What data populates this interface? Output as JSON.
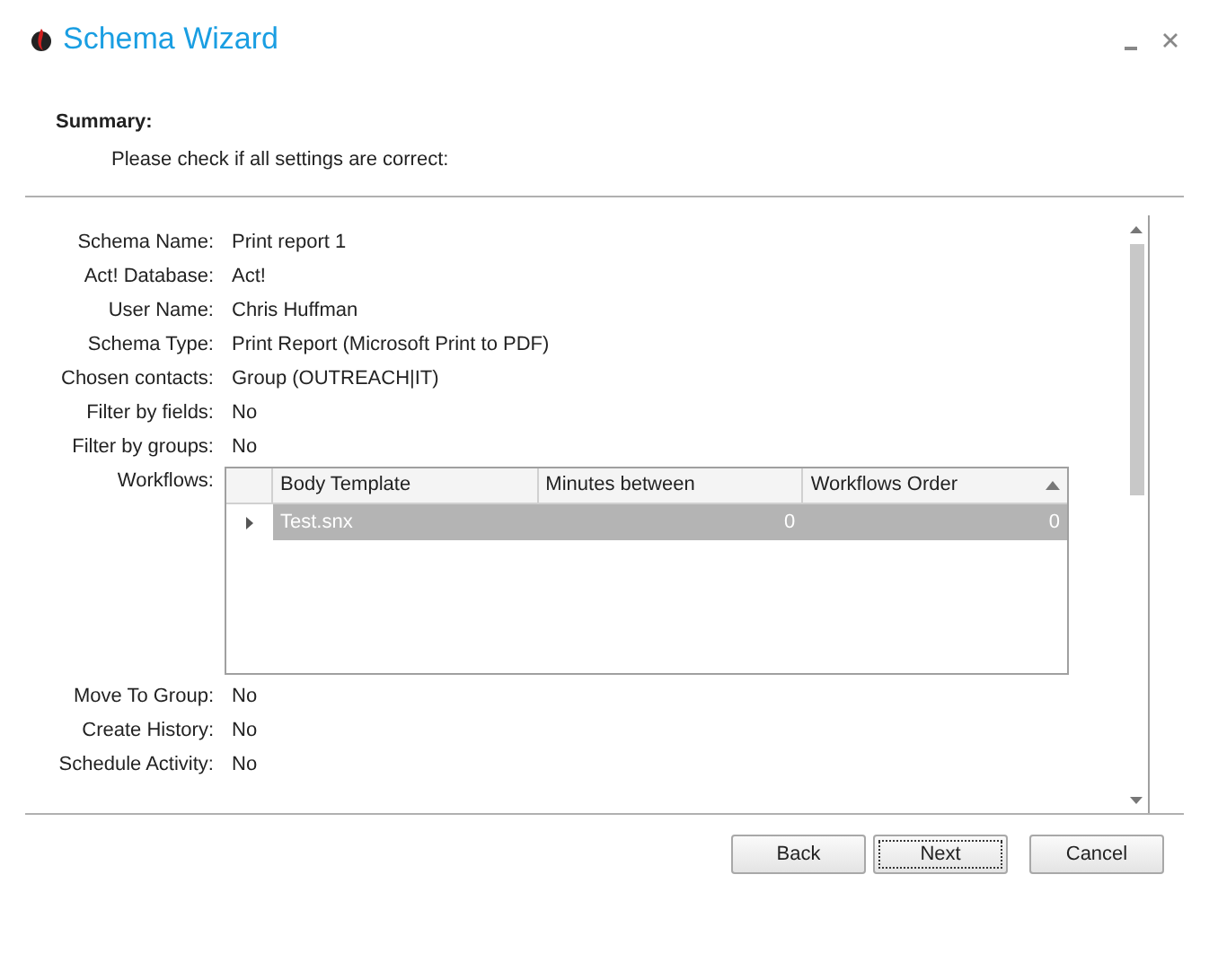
{
  "window": {
    "title": "Schema Wizard"
  },
  "header": {
    "title": "Summary:",
    "subtitle": "Please check if all settings are correct:"
  },
  "settings": [
    {
      "kind": "text",
      "label": "Schema Name:",
      "value": "Print report 1"
    },
    {
      "kind": "text",
      "label": "Act! Database:",
      "value": "Act!"
    },
    {
      "kind": "text",
      "label": "User Name:",
      "value": "Chris Huffman"
    },
    {
      "kind": "text",
      "label": "Schema Type:",
      "value": "Print Report (Microsoft Print to PDF)"
    },
    {
      "kind": "text",
      "label": "Chosen contacts:",
      "value": "Group (OUTREACH|IT)"
    },
    {
      "kind": "text",
      "label": "Filter by fields:",
      "value": "No"
    },
    {
      "kind": "text",
      "label": "Filter by groups:",
      "value": "No"
    },
    {
      "kind": "grid",
      "label": "Workflows:",
      "columns": [
        "Body Template",
        "Minutes between",
        "Workflows Order"
      ],
      "rows": [
        {
          "cells": [
            "Test.snx",
            "0",
            "0"
          ],
          "selected": true
        }
      ]
    },
    {
      "kind": "text",
      "label": "Move To Group:",
      "value": "No"
    },
    {
      "kind": "text",
      "label": "Create History:",
      "value": "No"
    },
    {
      "kind": "text",
      "label": "Schedule Activity:",
      "value": "No"
    }
  ],
  "buttons": [
    {
      "label": "Back",
      "focused": false
    },
    {
      "label": "Next",
      "focused": true
    },
    {
      "label": "Cancel",
      "focused": false
    }
  ]
}
